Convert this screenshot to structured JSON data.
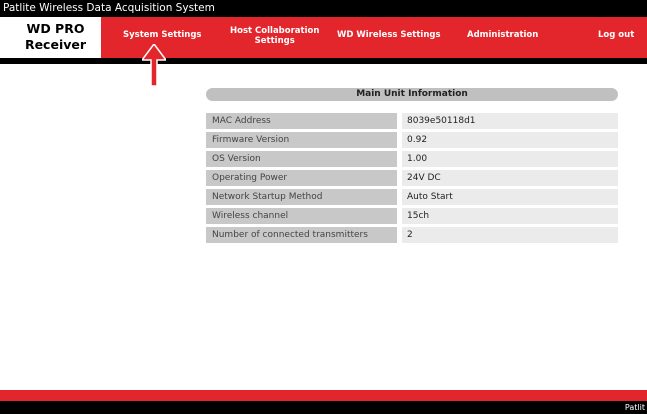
{
  "window": {
    "title": "Patlite Wireless Data Acquisition System"
  },
  "logo": {
    "line1": "WD PRO",
    "line2": "Receiver"
  },
  "nav": {
    "system_settings": "System Settings",
    "host_collab_line1": "Host Collaboration",
    "host_collab_line2": "Settings",
    "wd_wireless": "WD Wireless Settings",
    "administration": "Administration",
    "logout": "Log out"
  },
  "colors": {
    "brand_red": "#e3262c",
    "header_black": "#000000",
    "label_gray": "#c8c8c8",
    "value_gray": "#ebebeb"
  },
  "main": {
    "section_title": "Main Unit Information",
    "rows": [
      {
        "label": "MAC Address",
        "value": "8039e50118d1"
      },
      {
        "label": "Firmware Version",
        "value": "0.92"
      },
      {
        "label": "OS Version",
        "value": "1.00"
      },
      {
        "label": "Operating Power",
        "value": "24V DC"
      },
      {
        "label": "Network Startup Method",
        "value": "Auto Start"
      },
      {
        "label": "Wireless channel",
        "value": "15ch"
      },
      {
        "label": "Number of connected transmitters",
        "value": "2"
      }
    ]
  },
  "footer": {
    "brand": "Patlit"
  },
  "annotation": {
    "icon": "up-arrow-icon"
  }
}
